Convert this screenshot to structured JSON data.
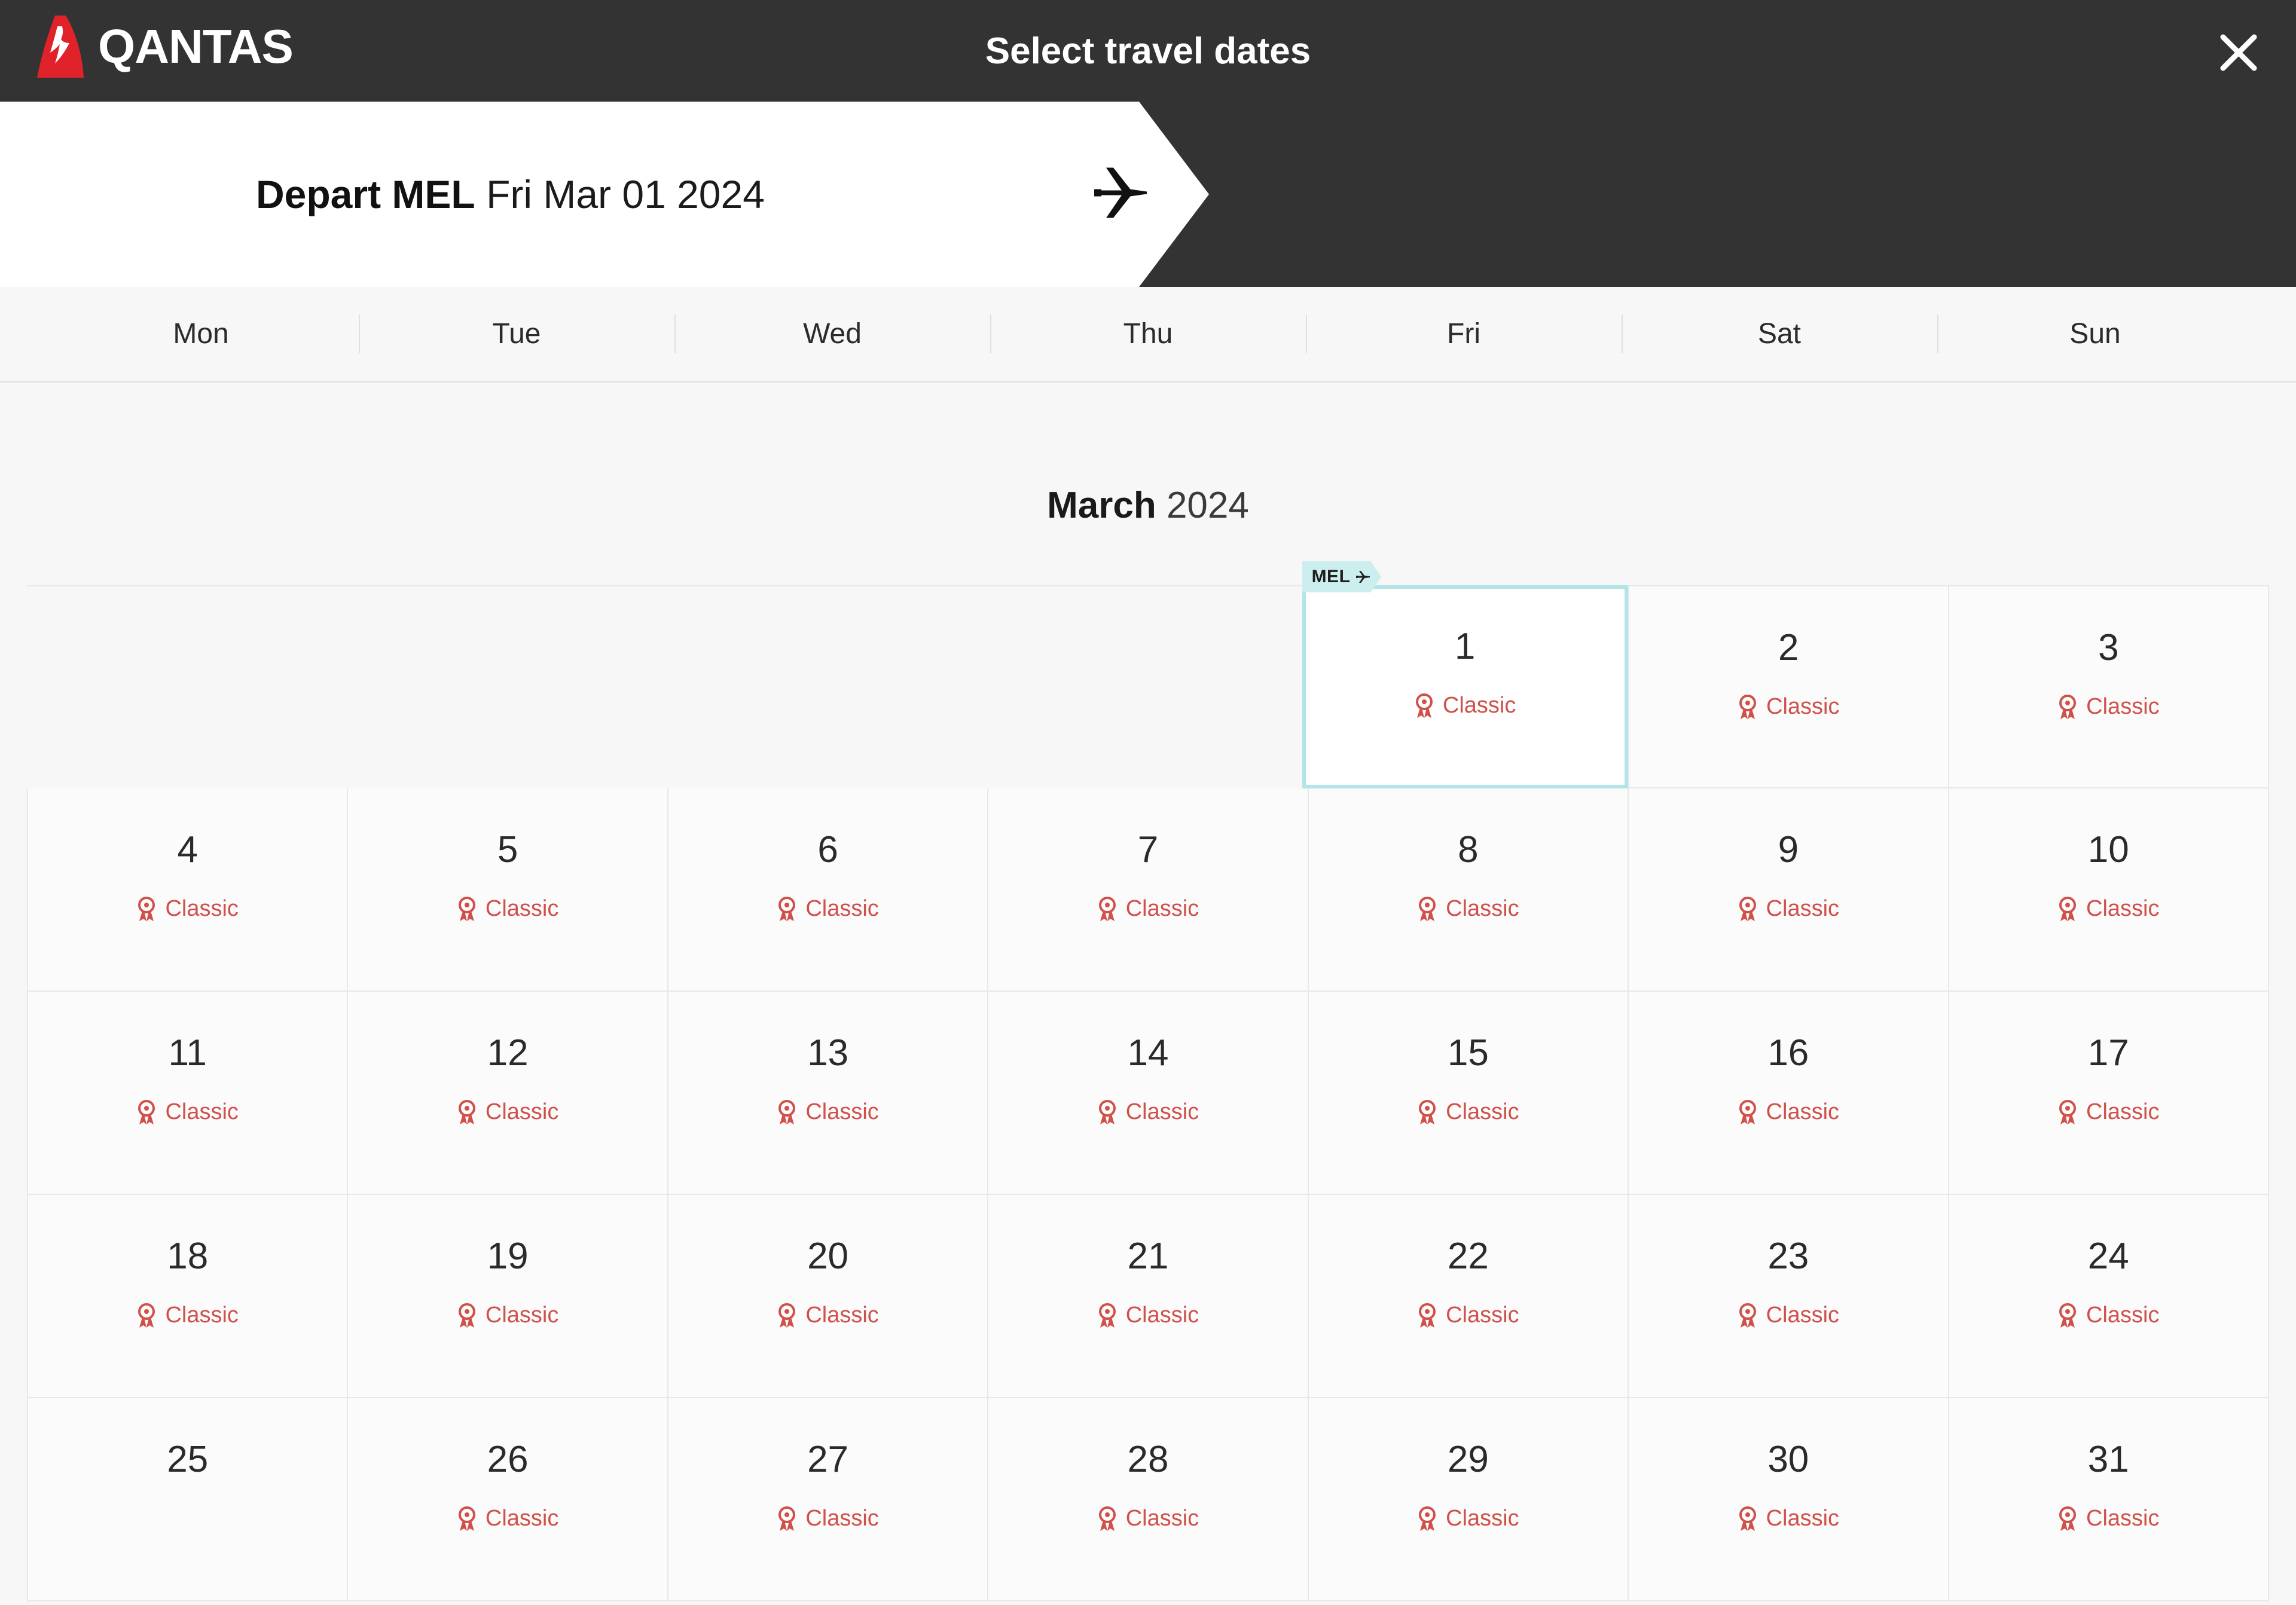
{
  "header": {
    "brand": "QANTAS",
    "title": "Select travel dates",
    "close_label": "×"
  },
  "depart_banner": {
    "prefix": "Depart MEL",
    "date": "Fri Mar 01 2024",
    "plane_icon": "airplane-icon"
  },
  "weekdays": [
    "Mon",
    "Tue",
    "Wed",
    "Thu",
    "Fri",
    "Sat",
    "Sun"
  ],
  "month": {
    "name": "March",
    "year": "2024"
  },
  "fare": {
    "label": "Classic",
    "icon": "award-ribbon-icon",
    "color": "#d0504a"
  },
  "selection": {
    "day": "1",
    "origin": "MEL",
    "origin_icon": "airplane-icon",
    "border_color": "#b2e4e8",
    "badge_color": "#cdeeef"
  },
  "colors": {
    "header_bg": "#333333",
    "page_bg": "#f7f7f7",
    "brand_red": "#e0222a",
    "cell_border": "#e8e8e8"
  },
  "weeks": [
    [
      {
        "day": "",
        "fare": "",
        "empty": true
      },
      {
        "day": "",
        "fare": "",
        "empty": true
      },
      {
        "day": "",
        "fare": "",
        "empty": true
      },
      {
        "day": "",
        "fare": "",
        "empty": true
      },
      {
        "day": "1",
        "fare": "Classic",
        "selected": true
      },
      {
        "day": "2",
        "fare": "Classic"
      },
      {
        "day": "3",
        "fare": "Classic"
      }
    ],
    [
      {
        "day": "4",
        "fare": "Classic"
      },
      {
        "day": "5",
        "fare": "Classic"
      },
      {
        "day": "6",
        "fare": "Classic"
      },
      {
        "day": "7",
        "fare": "Classic"
      },
      {
        "day": "8",
        "fare": "Classic"
      },
      {
        "day": "9",
        "fare": "Classic"
      },
      {
        "day": "10",
        "fare": "Classic"
      }
    ],
    [
      {
        "day": "11",
        "fare": "Classic"
      },
      {
        "day": "12",
        "fare": "Classic"
      },
      {
        "day": "13",
        "fare": "Classic"
      },
      {
        "day": "14",
        "fare": "Classic"
      },
      {
        "day": "15",
        "fare": "Classic"
      },
      {
        "day": "16",
        "fare": "Classic"
      },
      {
        "day": "17",
        "fare": "Classic"
      }
    ],
    [
      {
        "day": "18",
        "fare": "Classic"
      },
      {
        "day": "19",
        "fare": "Classic"
      },
      {
        "day": "20",
        "fare": "Classic"
      },
      {
        "day": "21",
        "fare": "Classic"
      },
      {
        "day": "22",
        "fare": "Classic"
      },
      {
        "day": "23",
        "fare": "Classic"
      },
      {
        "day": "24",
        "fare": "Classic"
      }
    ],
    [
      {
        "day": "25",
        "fare": ""
      },
      {
        "day": "26",
        "fare": "Classic"
      },
      {
        "day": "27",
        "fare": "Classic"
      },
      {
        "day": "28",
        "fare": "Classic"
      },
      {
        "day": "29",
        "fare": "Classic"
      },
      {
        "day": "30",
        "fare": "Classic"
      },
      {
        "day": "31",
        "fare": "Classic"
      }
    ]
  ]
}
